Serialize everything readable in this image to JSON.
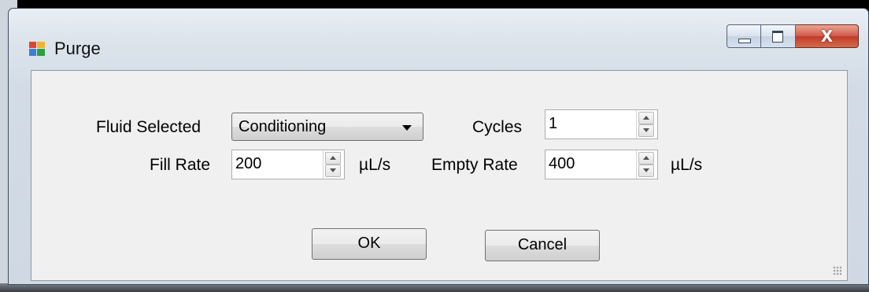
{
  "window": {
    "title": "Purge",
    "icon": "form-app-icon",
    "caption_icons": [
      "minimize-icon",
      "maximize-icon",
      "close-icon"
    ],
    "close_glyph": "X"
  },
  "form": {
    "fluid_label": "Fluid Selected",
    "fluid_value": "Conditioning",
    "cycles_label": "Cycles",
    "cycles_value": "1",
    "fill_rate_label": "Fill Rate",
    "fill_rate_value": "200",
    "fill_rate_unit": "µL/s",
    "empty_rate_label": "Empty Rate",
    "empty_rate_value": "400",
    "empty_rate_unit": "µL/s"
  },
  "buttons": {
    "ok": "OK",
    "cancel": "Cancel"
  },
  "colors": {
    "close_button": "#c13a28",
    "frame": "#d3dce6",
    "client": "#f0f0f0"
  }
}
